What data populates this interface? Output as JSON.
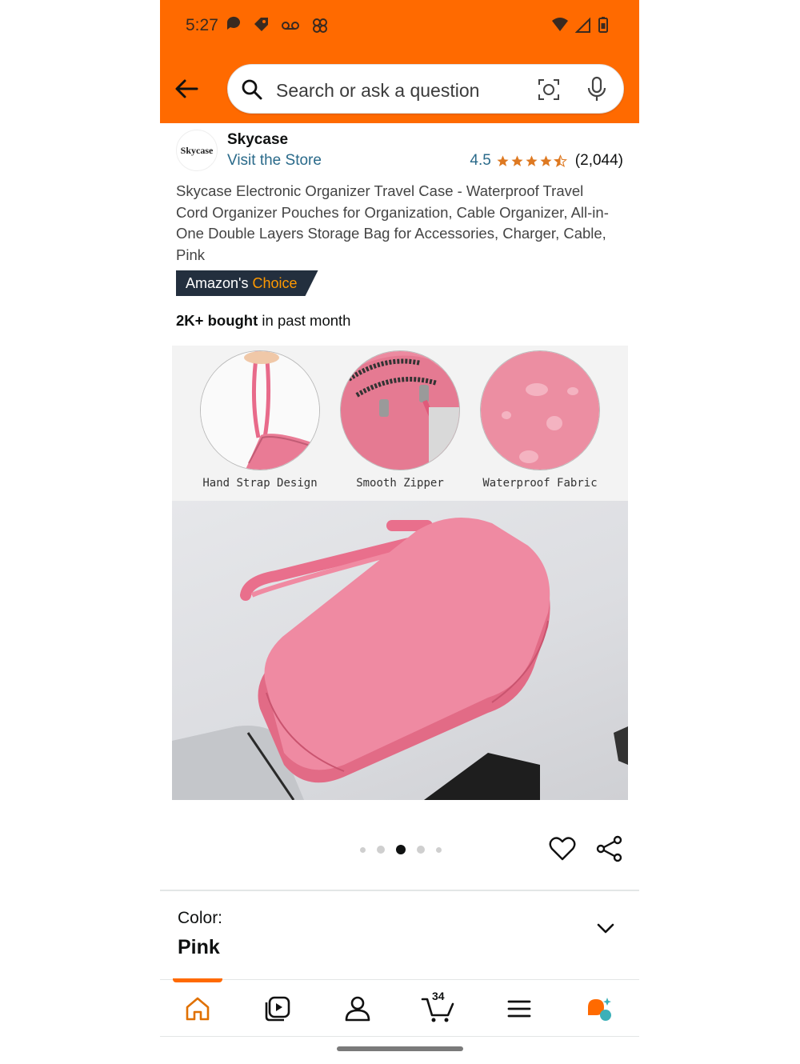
{
  "status_bar": {
    "time": "5:27"
  },
  "search": {
    "placeholder": "Search or ask a question"
  },
  "store": {
    "logo_text": "Skycase",
    "name": "Skycase",
    "visit_link": "Visit the Store",
    "rating_value": "4.5",
    "stars": 4.5,
    "rating_count": "(2,044)"
  },
  "product": {
    "title": "Skycase Electronic Organizer Travel Case - Waterproof Travel Cord Organizer Pouches for Organization, Cable Organizer, All-in-One Double Layers Storage Bag for Accessories, Charger, Cable, Pink",
    "badge_prefix": "Amazon's",
    "badge_suffix": "Choice",
    "bought_bold": "2K+ bought",
    "bought_rest": " in past month",
    "features": [
      "Hand Strap Design",
      "Smooth Zipper",
      "Waterproof Fabric"
    ],
    "carousel_active_index": 2,
    "carousel_total": 5
  },
  "variation": {
    "label": "Color:",
    "value": "Pink"
  },
  "bottom_nav": {
    "items": [
      "home-icon",
      "video-icon",
      "account-icon",
      "cart-icon",
      "menu-icon",
      "rufus-icon"
    ],
    "cart_count": "34",
    "active": "home-icon"
  },
  "colors": {
    "brand_orange": "#ff6a00",
    "link_blue": "#2a6a8a",
    "star_orange": "#de7921",
    "badge_navy": "#232f3e",
    "product_pink": "#ec7d98"
  }
}
